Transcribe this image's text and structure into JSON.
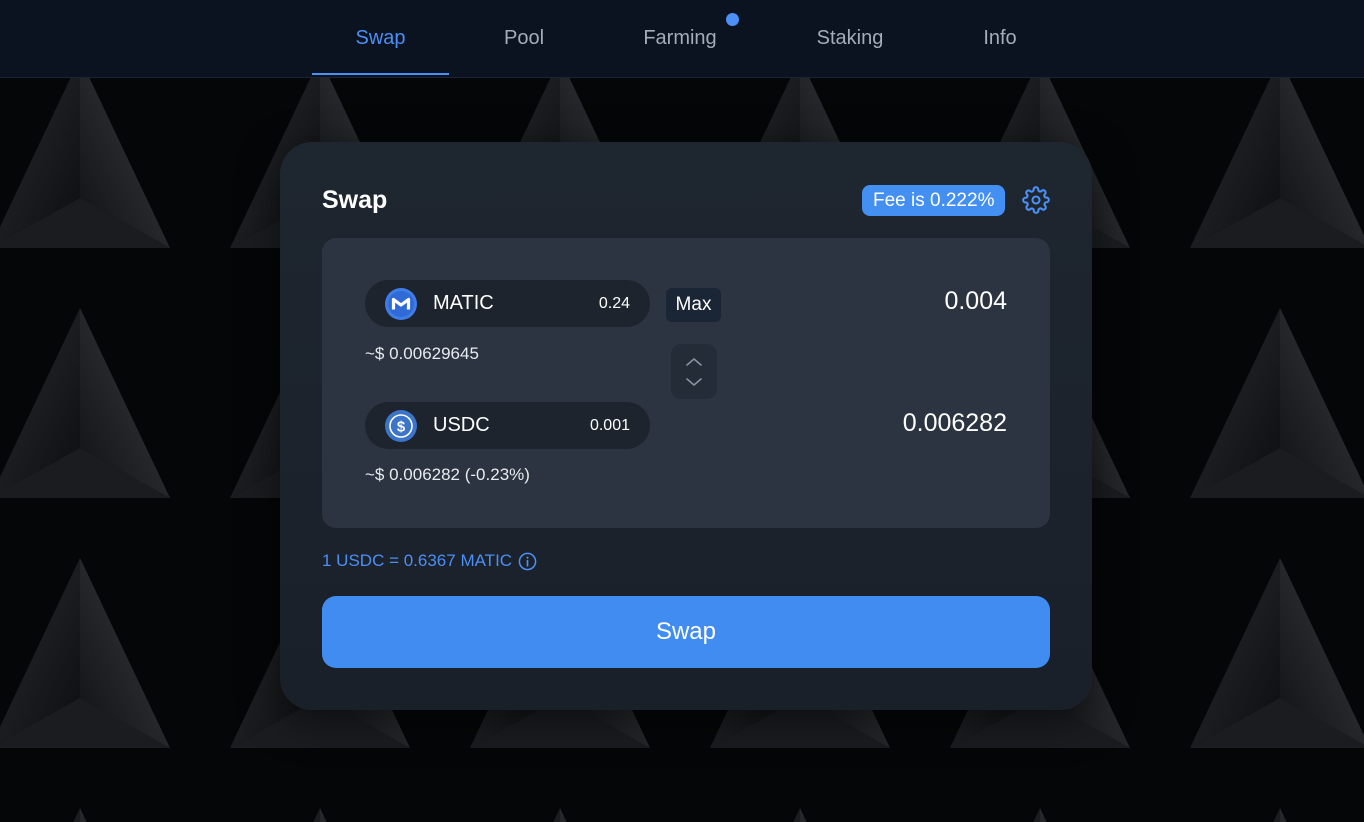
{
  "nav": {
    "items": [
      {
        "label": "Swap",
        "active": true
      },
      {
        "label": "Pool",
        "active": false
      },
      {
        "label": "Farming",
        "active": false,
        "notification_dot": true
      },
      {
        "label": "Staking",
        "active": false
      },
      {
        "label": "Info",
        "active": false
      }
    ]
  },
  "swap_card": {
    "title": "Swap",
    "fee_badge": "Fee is 0.222%",
    "settings_icon": "gear-icon",
    "from": {
      "token": "MATIC",
      "icon": "matic-token-icon",
      "balance": "0.24",
      "max_label": "Max",
      "amount": "0.004",
      "usd_value": "~$ 0.00629645"
    },
    "switch_icon": "chevron-up-down-icon",
    "to": {
      "token": "USDC",
      "icon": "usdc-token-icon",
      "balance": "0.001",
      "amount": "0.006282",
      "usd_value": "~$ 0.006282 (-0.23%)"
    },
    "rate": "1 USDC = 0.6367 MATIC",
    "rate_info_icon": "info-icon",
    "swap_button": "Swap"
  },
  "colors": {
    "accent": "#4c8ff5",
    "nav_bg": "#0b1220",
    "card_bg": "#1e2630",
    "panel_bg": "#2b3440",
    "button": "#418cf0"
  }
}
